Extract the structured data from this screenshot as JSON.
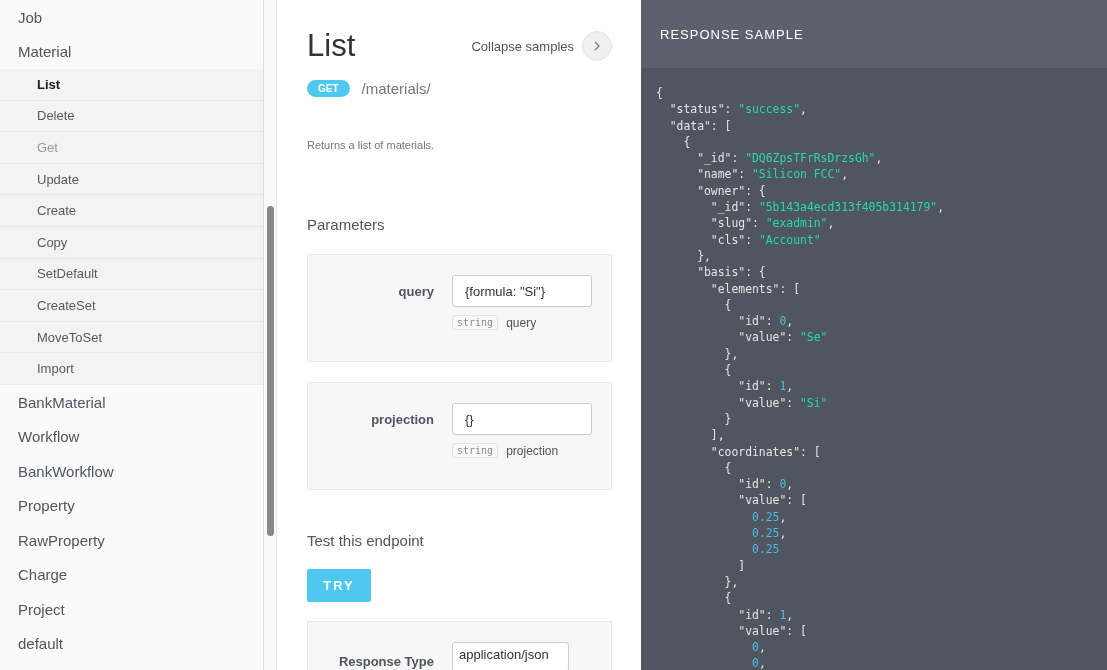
{
  "sidebar": {
    "items": [
      {
        "label": "Job"
      },
      {
        "label": "Material",
        "children": [
          {
            "label": "List",
            "selected": true,
            "disabled": false
          },
          {
            "label": "Delete",
            "selected": false,
            "disabled": false
          },
          {
            "label": "Get",
            "selected": false,
            "disabled": true
          },
          {
            "label": "Update",
            "selected": false,
            "disabled": false
          },
          {
            "label": "Create",
            "selected": false,
            "disabled": false
          },
          {
            "label": "Copy",
            "selected": false,
            "disabled": false
          },
          {
            "label": "SetDefault",
            "selected": false,
            "disabled": false
          },
          {
            "label": "CreateSet",
            "selected": false,
            "disabled": false
          },
          {
            "label": "MoveToSet",
            "selected": false,
            "disabled": false
          },
          {
            "label": "Import",
            "selected": false,
            "disabled": false
          }
        ]
      },
      {
        "label": "BankMaterial"
      },
      {
        "label": "Workflow"
      },
      {
        "label": "BankWorkflow"
      },
      {
        "label": "Property"
      },
      {
        "label": "RawProperty"
      },
      {
        "label": "Charge"
      },
      {
        "label": "Project"
      },
      {
        "label": "default"
      }
    ]
  },
  "endpoint": {
    "title": "List",
    "collapse_label": "Collapse samples",
    "method": "GET",
    "path": "/materials/",
    "description": "Returns a list of materials.",
    "parameters_heading": "Parameters",
    "parameters": [
      {
        "name": "query",
        "value": "{formula: \"Si\"}",
        "type": "string",
        "description": "query"
      },
      {
        "name": "projection",
        "value": "{}",
        "type": "string",
        "description": "projection"
      }
    ],
    "test_heading": "Test this endpoint",
    "try_label": "TRY",
    "response_type_label": "Response Type",
    "response_type_value": "application/json"
  },
  "response_sample": {
    "title": "RESPONSE SAMPLE",
    "lines": [
      [
        {
          "text": "{",
          "kind": "plain"
        }
      ],
      [
        {
          "text": "  \"status\": ",
          "kind": "plain"
        },
        {
          "text": "\"success\"",
          "kind": "string"
        },
        {
          "text": ",",
          "kind": "plain"
        }
      ],
      [
        {
          "text": "  \"data\": [",
          "kind": "plain"
        }
      ],
      [
        {
          "text": "    {",
          "kind": "plain"
        }
      ],
      [
        {
          "text": "      \"_id\": ",
          "kind": "plain"
        },
        {
          "text": "\"DQ6ZpsTFrRsDrzsGh\"",
          "kind": "string"
        },
        {
          "text": ",",
          "kind": "plain"
        }
      ],
      [
        {
          "text": "      \"name\": ",
          "kind": "plain"
        },
        {
          "text": "\"Silicon FCC\"",
          "kind": "string"
        },
        {
          "text": ",",
          "kind": "plain"
        }
      ],
      [
        {
          "text": "      \"owner\": {",
          "kind": "plain"
        }
      ],
      [
        {
          "text": "        \"_id\": ",
          "kind": "plain"
        },
        {
          "text": "\"5b143a4ecd313f405b314179\"",
          "kind": "string"
        },
        {
          "text": ",",
          "kind": "plain"
        }
      ],
      [
        {
          "text": "        \"slug\": ",
          "kind": "plain"
        },
        {
          "text": "\"exadmin\"",
          "kind": "string"
        },
        {
          "text": ",",
          "kind": "plain"
        }
      ],
      [
        {
          "text": "        \"cls\": ",
          "kind": "plain"
        },
        {
          "text": "\"Account\"",
          "kind": "string"
        }
      ],
      [
        {
          "text": "      },",
          "kind": "plain"
        }
      ],
      [
        {
          "text": "      \"basis\": {",
          "kind": "plain"
        }
      ],
      [
        {
          "text": "        \"elements\": [",
          "kind": "plain"
        }
      ],
      [
        {
          "text": "          {",
          "kind": "plain"
        }
      ],
      [
        {
          "text": "            \"id\": ",
          "kind": "plain"
        },
        {
          "text": "0",
          "kind": "number"
        },
        {
          "text": ",",
          "kind": "plain"
        }
      ],
      [
        {
          "text": "            \"value\": ",
          "kind": "plain"
        },
        {
          "text": "\"Se\"",
          "kind": "string"
        }
      ],
      [
        {
          "text": "          },",
          "kind": "plain"
        }
      ],
      [
        {
          "text": "          {",
          "kind": "plain"
        }
      ],
      [
        {
          "text": "            \"id\": ",
          "kind": "plain"
        },
        {
          "text": "1",
          "kind": "number"
        },
        {
          "text": ",",
          "kind": "plain"
        }
      ],
      [
        {
          "text": "            \"value\": ",
          "kind": "plain"
        },
        {
          "text": "\"Si\"",
          "kind": "string"
        }
      ],
      [
        {
          "text": "          }",
          "kind": "plain"
        }
      ],
      [
        {
          "text": "        ],",
          "kind": "plain"
        }
      ],
      [
        {
          "text": "        \"coordinates\": [",
          "kind": "plain"
        }
      ],
      [
        {
          "text": "          {",
          "kind": "plain"
        }
      ],
      [
        {
          "text": "            \"id\": ",
          "kind": "plain"
        },
        {
          "text": "0",
          "kind": "number"
        },
        {
          "text": ",",
          "kind": "plain"
        }
      ],
      [
        {
          "text": "            \"value\": [",
          "kind": "plain"
        }
      ],
      [
        {
          "text": "              0.25",
          "kind": "number"
        },
        {
          "text": ",",
          "kind": "plain"
        }
      ],
      [
        {
          "text": "              0.25",
          "kind": "number"
        },
        {
          "text": ",",
          "kind": "plain"
        }
      ],
      [
        {
          "text": "              0.25",
          "kind": "number"
        }
      ],
      [
        {
          "text": "            ]",
          "kind": "plain"
        }
      ],
      [
        {
          "text": "          },",
          "kind": "plain"
        }
      ],
      [
        {
          "text": "          {",
          "kind": "plain"
        }
      ],
      [
        {
          "text": "            \"id\": ",
          "kind": "plain"
        },
        {
          "text": "1",
          "kind": "number"
        },
        {
          "text": ",",
          "kind": "plain"
        }
      ],
      [
        {
          "text": "            \"value\": [",
          "kind": "plain"
        }
      ],
      [
        {
          "text": "              0",
          "kind": "number"
        },
        {
          "text": ",",
          "kind": "plain"
        }
      ],
      [
        {
          "text": "              0",
          "kind": "number"
        },
        {
          "text": ",",
          "kind": "plain"
        }
      ]
    ]
  }
}
